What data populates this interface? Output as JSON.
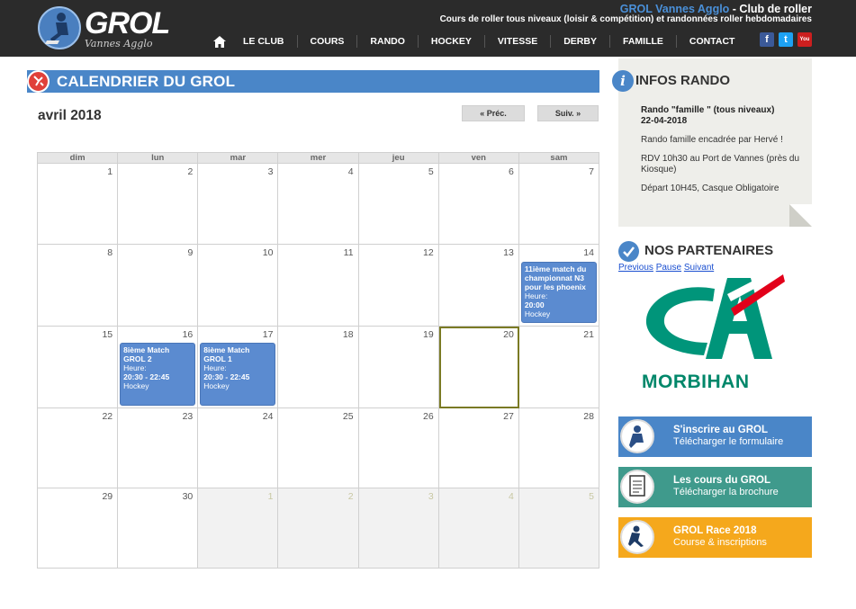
{
  "header": {
    "logo_text": "GROL",
    "logo_sub": "Vannes Agglo",
    "title_highlight": "GROL Vannes Agglo",
    "title_rest": " - Club de roller",
    "subtitle": "Cours de roller tous niveaux (loisir & compétition) et randonnées roller hebdomadaires",
    "nav": [
      "LE CLUB",
      "COURS",
      "RANDO",
      "HOCKEY",
      "VITESSE",
      "DERBY",
      "FAMILLE",
      "CONTACT"
    ],
    "social": {
      "facebook": "f",
      "twitter": "t",
      "youtube": "You"
    }
  },
  "calendar": {
    "section_title": "CALENDRIER DU GROL",
    "month": "avril 2018",
    "prev_label": "« Préc.",
    "next_label": "Suiv. »",
    "weekdays": [
      "dim",
      "lun",
      "mar",
      "mer",
      "jeu",
      "ven",
      "sam"
    ],
    "weeks": [
      [
        "1",
        "2",
        "3",
        "4",
        "5",
        "6",
        "7"
      ],
      [
        "8",
        "9",
        "10",
        "11",
        "12",
        "13",
        "14"
      ],
      [
        "15",
        "16",
        "17",
        "18",
        "19",
        "20",
        "21"
      ],
      [
        "22",
        "23",
        "24",
        "25",
        "26",
        "27",
        "28"
      ],
      [
        "29",
        "30",
        "1",
        "2",
        "3",
        "4",
        "5"
      ]
    ],
    "events": [
      {
        "title": "11ième match du championnat N3 pour les phoenix",
        "time_label": "Heure:",
        "time": "20:00",
        "category": "Hockey"
      },
      {
        "title": "8ième Match GROL 2",
        "time_label": "Heure:",
        "time": "20:30 - 22:45",
        "category": "Hockey"
      },
      {
        "title": "8ième Match GROL 1",
        "time_label": "Heure:",
        "time": "20:30 - 22:45",
        "category": "Hockey"
      }
    ]
  },
  "infos_rando": {
    "title": "INFOS RANDO",
    "rando_name": "Rando \"famille \" (tous niveaux)",
    "rando_date": "22-04-2018",
    "lines": [
      "Rando famille encadrée par Hervé !",
      "RDV 10h30 au Port de Vannes (près du Kiosque)",
      "Départ 10H45, Casque Obligatoire"
    ]
  },
  "partners": {
    "title": "NOS PARTENAIRES",
    "links": [
      "Previous",
      "Pause",
      "Suivant"
    ],
    "logo_text": "MORBIHAN"
  },
  "promos": [
    {
      "line1": "S'inscrire au GROL",
      "line2": "Télécharger le formulaire",
      "color": "#4a86c8"
    },
    {
      "line1": "Les cours du GROL",
      "line2": "Télécharger la brochure",
      "color": "#3f9a8c"
    },
    {
      "line1": "GROL Race 2018",
      "line2": "Course & inscriptions",
      "color": "#f5a81c"
    }
  ],
  "colors": {
    "header_bg": "#2b2b2b",
    "accent_blue": "#4a86c8",
    "event_blue": "#5b8bd0",
    "ca_green": "#00876a",
    "ca_red": "#e2001a"
  }
}
